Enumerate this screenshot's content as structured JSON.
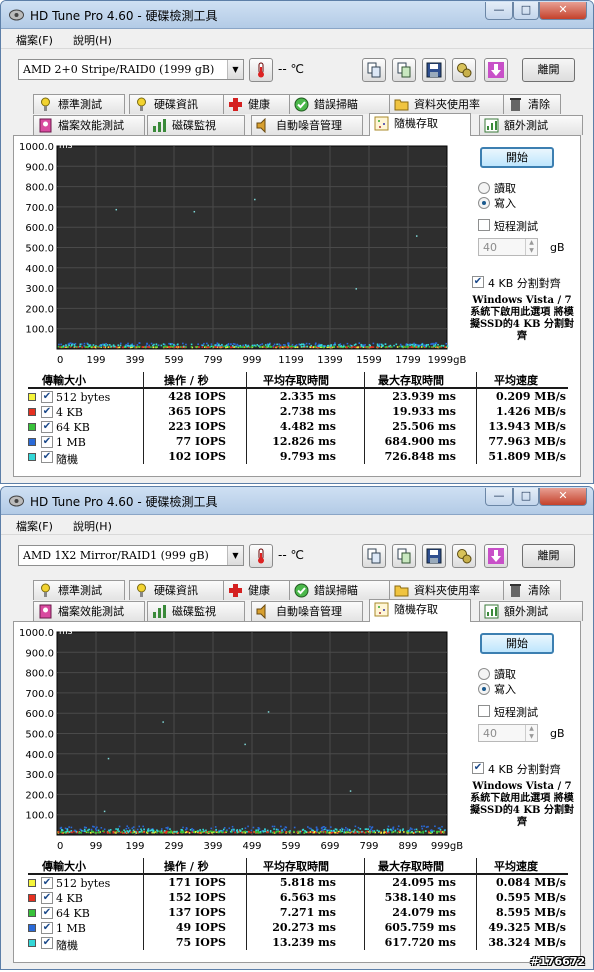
{
  "windows": [
    {
      "title": "HD Tune Pro 4.60 - 硬碟檢測工具",
      "menu": [
        "檔案(F)",
        "說明(H)"
      ],
      "drive": "AMD     2+0 Stripe/RAID0 (1999 gB)",
      "temperature": "-- ℃",
      "exit_label": "離開",
      "tabs_top": [
        "標準測試",
        "硬碟資訊",
        "健康",
        "錯誤掃瞄",
        "資料夾使用率",
        "清除"
      ],
      "tabs_bottom": [
        "檔案效能測試",
        "磁碟監視",
        "自動噪音管理",
        "隨機存取",
        "額外測試"
      ],
      "active_tab": "隨機存取",
      "start_label": "開始",
      "mode": {
        "read": "讀取",
        "write": "寫入",
        "selected": "寫入"
      },
      "short_test": {
        "label": "短程測試",
        "checked": false,
        "size": "40",
        "unit": "gB"
      },
      "align": {
        "label": "4 KB 分割對齊",
        "checked": true,
        "note": "Windows Vista / 7 系統下啟用此選項 將模擬SSD的4 KB 分割對齊"
      },
      "table": {
        "headers": [
          "傳輸大小",
          "操作 / 秒",
          "平均存取時間",
          "最大存取時間",
          "平均速度"
        ],
        "rows": [
          {
            "label": "512 bytes",
            "color": "#f5f53a",
            "ops": "428 IOPS",
            "avg": "2.335 ms",
            "max": "23.939 ms",
            "speed": "0.209 MB/s"
          },
          {
            "label": "4 KB",
            "color": "#e53020",
            "ops": "365 IOPS",
            "avg": "2.738 ms",
            "max": "19.933 ms",
            "speed": "1.426 MB/s"
          },
          {
            "label": "64 KB",
            "color": "#38c23a",
            "ops": "223 IOPS",
            "avg": "4.482 ms",
            "max": "25.506 ms",
            "speed": "13.943 MB/s"
          },
          {
            "label": "1 MB",
            "color": "#2a6ad8",
            "ops": "77 IOPS",
            "avg": "12.826 ms",
            "max": "684.900 ms",
            "speed": "77.963 MB/s"
          },
          {
            "label": "隨機",
            "color": "#34d8d8",
            "ops": "102 IOPS",
            "avg": "9.793 ms",
            "max": "726.848 ms",
            "speed": "51.809 MB/s"
          }
        ]
      },
      "chart_data": {
        "type": "scatter",
        "ylabel": "ms",
        "y_ticks": [
          "1000.0",
          "900.0",
          "800.0",
          "700.0",
          "600.0",
          "500.0",
          "400.0",
          "300.0",
          "200.0",
          "100.0"
        ],
        "x_ticks": [
          "0",
          "199",
          "399",
          "599",
          "799",
          "999",
          "1199",
          "1399",
          "1599",
          "1799",
          "1999gB"
        ],
        "xlim": [
          0,
          1999
        ],
        "ylim": [
          0,
          1000
        ],
        "series": [
          {
            "name": "512 bytes",
            "typical_ms": 2.3
          },
          {
            "name": "4 KB",
            "typical_ms": 2.7
          },
          {
            "name": "64 KB",
            "typical_ms": 4.5
          },
          {
            "name": "1 MB",
            "typical_ms": 12.8
          },
          {
            "name": "隨機",
            "typical_ms": 9.8
          }
        ],
        "outliers": [
          [
            700,
            680
          ],
          [
            1010,
            740
          ],
          [
            300,
            690
          ],
          [
            1530,
            300
          ],
          [
            1840,
            560
          ]
        ],
        "grid": true
      }
    },
    {
      "title": "HD Tune Pro 4.60 - 硬碟檢測工具",
      "menu": [
        "檔案(F)",
        "說明(H)"
      ],
      "drive": "AMD     1X2 Mirror/RAID1 (999 gB)",
      "temperature": "-- ℃",
      "exit_label": "離開",
      "tabs_top": [
        "標準測試",
        "硬碟資訊",
        "健康",
        "錯誤掃瞄",
        "資料夾使用率",
        "清除"
      ],
      "tabs_bottom": [
        "檔案效能測試",
        "磁碟監視",
        "自動噪音管理",
        "隨機存取",
        "額外測試"
      ],
      "active_tab": "隨機存取",
      "start_label": "開始",
      "mode": {
        "read": "讀取",
        "write": "寫入",
        "selected": "寫入"
      },
      "short_test": {
        "label": "短程測試",
        "checked": false,
        "size": "40",
        "unit": "gB"
      },
      "align": {
        "label": "4 KB 分割對齊",
        "checked": true,
        "note": "Windows Vista / 7 系統下啟用此選項 將模擬SSD的4 KB 分割對齊"
      },
      "table": {
        "headers": [
          "傳輸大小",
          "操作 / 秒",
          "平均存取時間",
          "最大存取時間",
          "平均速度"
        ],
        "rows": [
          {
            "label": "512 bytes",
            "color": "#f5f53a",
            "ops": "171 IOPS",
            "avg": "5.818 ms",
            "max": "24.095 ms",
            "speed": "0.084 MB/s"
          },
          {
            "label": "4 KB",
            "color": "#e53020",
            "ops": "152 IOPS",
            "avg": "6.563 ms",
            "max": "538.140 ms",
            "speed": "0.595 MB/s"
          },
          {
            "label": "64 KB",
            "color": "#38c23a",
            "ops": "137 IOPS",
            "avg": "7.271 ms",
            "max": "24.079 ms",
            "speed": "8.595 MB/s"
          },
          {
            "label": "1 MB",
            "color": "#2a6ad8",
            "ops": "49 IOPS",
            "avg": "20.273 ms",
            "max": "605.759 ms",
            "speed": "49.325 MB/s"
          },
          {
            "label": "隨機",
            "color": "#34d8d8",
            "ops": "75 IOPS",
            "avg": "13.239 ms",
            "max": "617.720 ms",
            "speed": "38.324 MB/s"
          }
        ]
      },
      "chart_data": {
        "type": "scatter",
        "ylabel": "ms",
        "y_ticks": [
          "1000.0",
          "900.0",
          "800.0",
          "700.0",
          "600.0",
          "500.0",
          "400.0",
          "300.0",
          "200.0",
          "100.0"
        ],
        "x_ticks": [
          "0",
          "99",
          "199",
          "299",
          "399",
          "499",
          "599",
          "699",
          "799",
          "899",
          "999gB"
        ],
        "xlim": [
          0,
          999
        ],
        "ylim": [
          0,
          1000
        ],
        "series": [
          {
            "name": "512 bytes",
            "typical_ms": 5.8
          },
          {
            "name": "4 KB",
            "typical_ms": 6.6
          },
          {
            "name": "64 KB",
            "typical_ms": 7.3
          },
          {
            "name": "1 MB",
            "typical_ms": 20.3
          },
          {
            "name": "隨機",
            "typical_ms": 13.2
          }
        ],
        "outliers": [
          [
            270,
            560
          ],
          [
            480,
            450
          ],
          [
            540,
            610
          ],
          [
            130,
            380
          ],
          [
            750,
            220
          ],
          [
            120,
            120
          ]
        ],
        "grid": true
      }
    }
  ],
  "watermark": "#176672"
}
